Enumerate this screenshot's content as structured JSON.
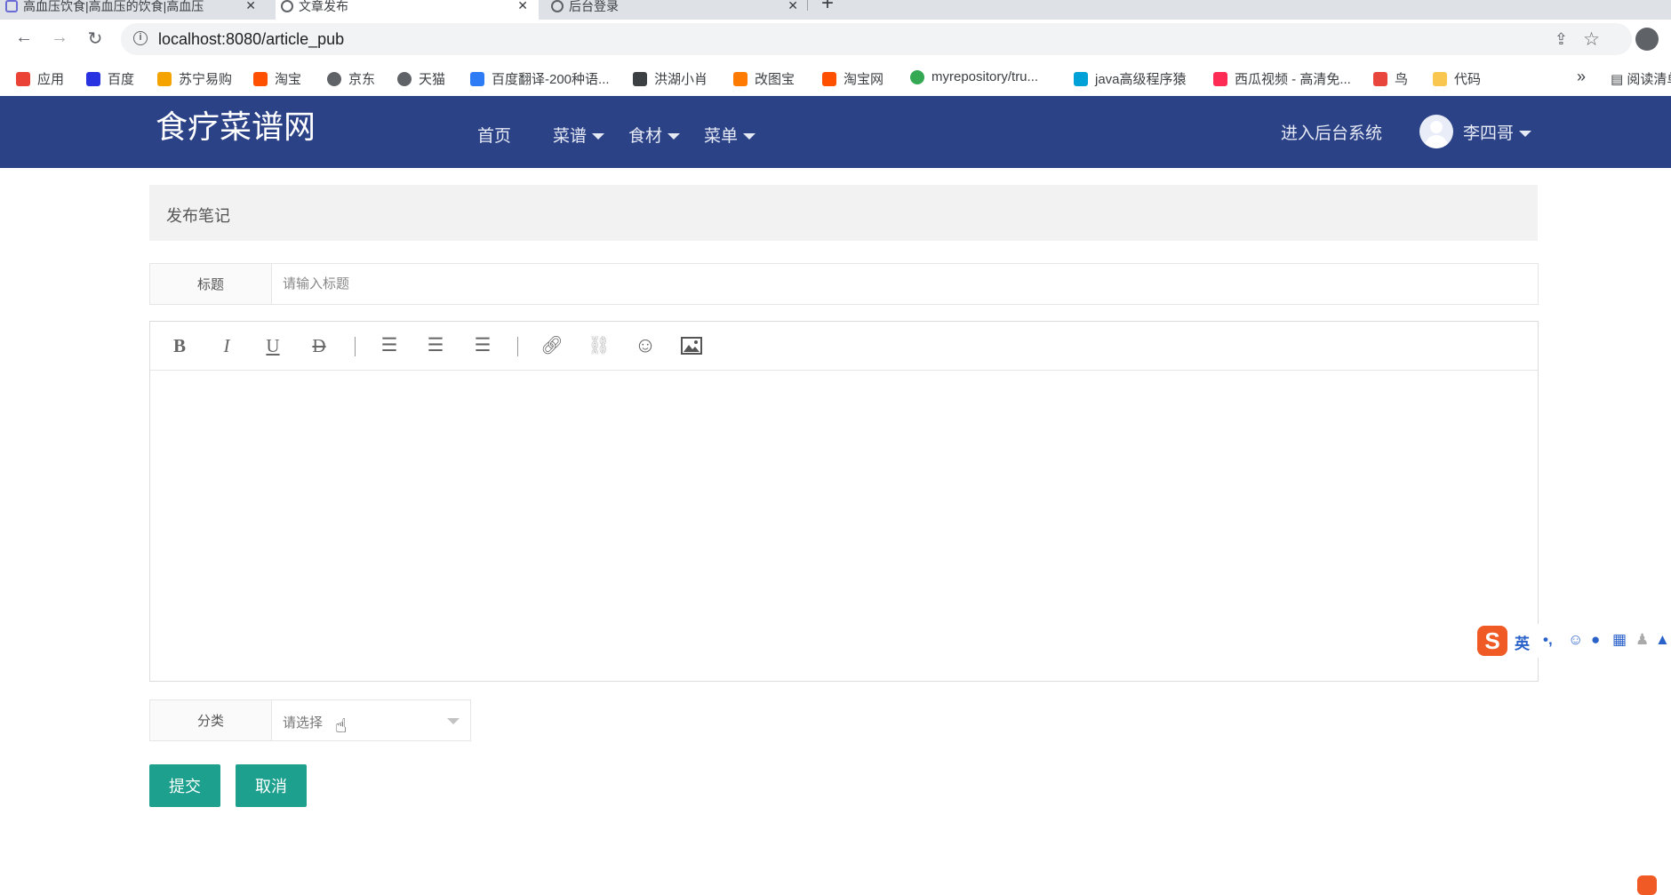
{
  "browser": {
    "tabs": [
      {
        "title": "高血压饮食|高血压的饮食|高血压",
        "active": false
      },
      {
        "title": "文章发布",
        "active": true
      },
      {
        "title": "后台登录",
        "active": false
      }
    ],
    "url": "localhost:8080/article_pub",
    "bookmarks": [
      {
        "label": "应用",
        "icon": "apps-grid-icon",
        "color": "#ea4335"
      },
      {
        "label": "百度",
        "icon": "baidu-paw-icon",
        "color": "#2932e1"
      },
      {
        "label": "苏宁易购",
        "icon": "suning-lion-icon",
        "color": "#f5a300"
      },
      {
        "label": "淘宝",
        "icon": "taobao-icon",
        "color": "#ff5000"
      },
      {
        "label": "京东",
        "icon": "globe-icon",
        "color": "#5f6368"
      },
      {
        "label": "天猫",
        "icon": "globe-icon",
        "color": "#5f6368"
      },
      {
        "label": "百度翻译-200种语...",
        "icon": "translate-icon",
        "color": "#2d7cf6"
      },
      {
        "label": "洪湖小肖",
        "icon": "bird-icon",
        "color": "#3c4043"
      },
      {
        "label": "改图宝",
        "icon": "gaitubao-icon",
        "color": "#ff7a00"
      },
      {
        "label": "淘宝网",
        "icon": "taobao-icon",
        "color": "#ff5000"
      },
      {
        "label": "myrepository/tru...",
        "icon": "chrome-icon",
        "color": "#34a853"
      },
      {
        "label": "java高级程序猿",
        "icon": "bilibili-icon",
        "color": "#00a1d6"
      },
      {
        "label": "西瓜视频 - 高清免...",
        "icon": "xigua-play-icon",
        "color": "#fe2c55"
      },
      {
        "label": "鸟",
        "icon": "bird-icon",
        "color": "#e8453c"
      },
      {
        "label": "代码",
        "icon": "code-icon",
        "color": "#f9c74f"
      }
    ],
    "more_label": "»",
    "reading_list": "阅读清单"
  },
  "site": {
    "logo": "食疗菜谱网",
    "nav": [
      {
        "label": "首页",
        "dropdown": false
      },
      {
        "label": "菜谱",
        "dropdown": true
      },
      {
        "label": "食材",
        "dropdown": true
      },
      {
        "label": "菜单",
        "dropdown": true
      }
    ],
    "admin_link": "进入后台系统",
    "user_name": "李四哥",
    "header_color": "#2c4287"
  },
  "form": {
    "panel_title": "发布笔记",
    "title_label": "标题",
    "title_placeholder": "请输入标题",
    "title_value": "",
    "editor_tools": [
      "bold-icon",
      "italic-icon",
      "underline-icon",
      "strikethrough-icon",
      "align-left-icon",
      "align-center-icon",
      "align-right-icon",
      "link-icon",
      "unlink-icon",
      "emoji-icon",
      "image-icon"
    ],
    "category_label": "分类",
    "category_placeholder": "请选择",
    "submit_label": "提交",
    "cancel_label": "取消",
    "button_color": "#1ea08f"
  },
  "ime": {
    "mode": "英",
    "punct": "•,"
  }
}
